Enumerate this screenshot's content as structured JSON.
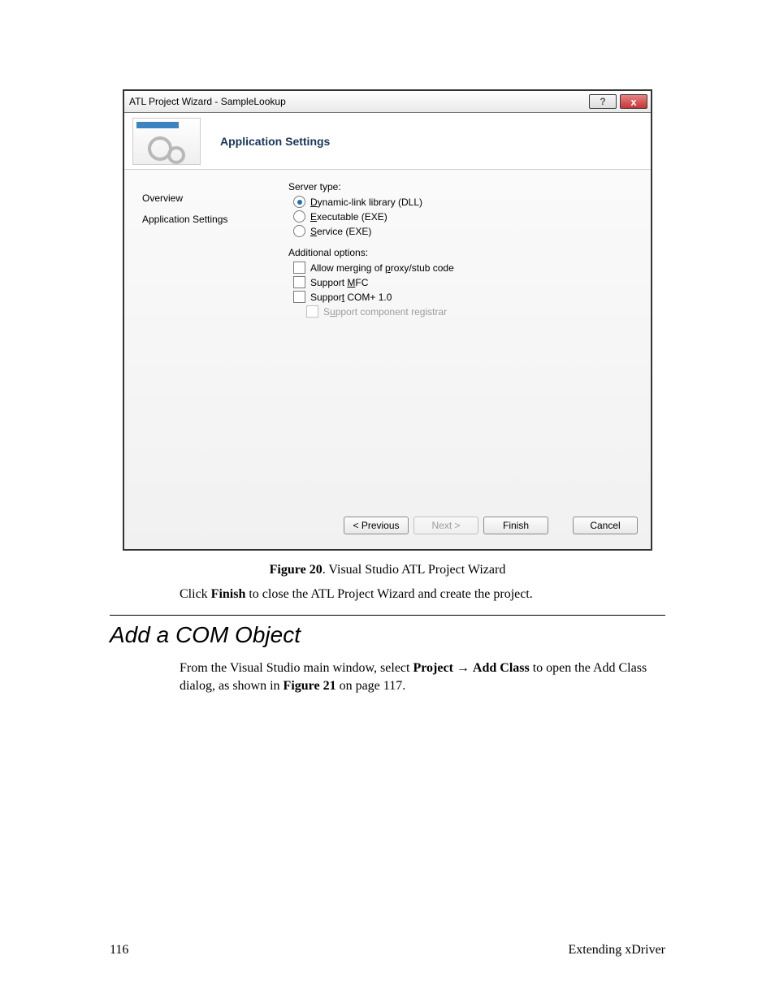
{
  "dialog": {
    "window_title": "ATL Project Wizard - SampleLookup",
    "help_symbol": "?",
    "close_symbol": "x",
    "header_title": "Application Settings",
    "sidebar": {
      "items": [
        {
          "label": "Overview"
        },
        {
          "label": "Application Settings"
        }
      ]
    },
    "server_type": {
      "label": "Server type:",
      "options": [
        {
          "label_pre": "",
          "underline": "D",
          "label_post": "ynamic-link library (DLL)",
          "selected": true
        },
        {
          "label_pre": "",
          "underline": "E",
          "label_post": "xecutable (EXE)",
          "selected": false
        },
        {
          "label_pre": "",
          "underline": "S",
          "label_post": "ervice (EXE)",
          "selected": false
        }
      ]
    },
    "additional_options": {
      "label": "Additional options:",
      "items": [
        {
          "label_pre": "Allow merging of ",
          "underline": "p",
          "label_post": "roxy/stub code",
          "checked": false,
          "disabled": false
        },
        {
          "label_pre": "Support ",
          "underline": "M",
          "label_post": "FC",
          "checked": false,
          "disabled": false
        },
        {
          "label_pre": "Suppor",
          "underline": "t",
          "label_post": " COM+ 1.0",
          "checked": false,
          "disabled": false
        },
        {
          "label_pre": "S",
          "underline": "u",
          "label_post": "pport component registrar",
          "checked": false,
          "disabled": true
        }
      ]
    },
    "buttons": {
      "previous": "< Previous",
      "next": "Next >",
      "finish": "Finish",
      "cancel": "Cancel"
    }
  },
  "caption": {
    "figure_label": "Figure 20",
    "text": ". Visual Studio ATL Project Wizard"
  },
  "body_line_1": {
    "pre": "Click ",
    "bold": "Finish",
    "post": " to close the ATL Project Wizard and create the project."
  },
  "heading": "Add a COM Object",
  "body_para": {
    "seg1": "From the Visual Studio main window, select ",
    "bold1": "Project",
    "arrow": " → ",
    "bold2": "Add Class",
    "seg2": " to open the Add Class dialog, as shown in ",
    "bold3": "Figure 21",
    "seg3": " on page 117."
  },
  "footer": {
    "page_number": "116",
    "section": "Extending xDriver"
  }
}
